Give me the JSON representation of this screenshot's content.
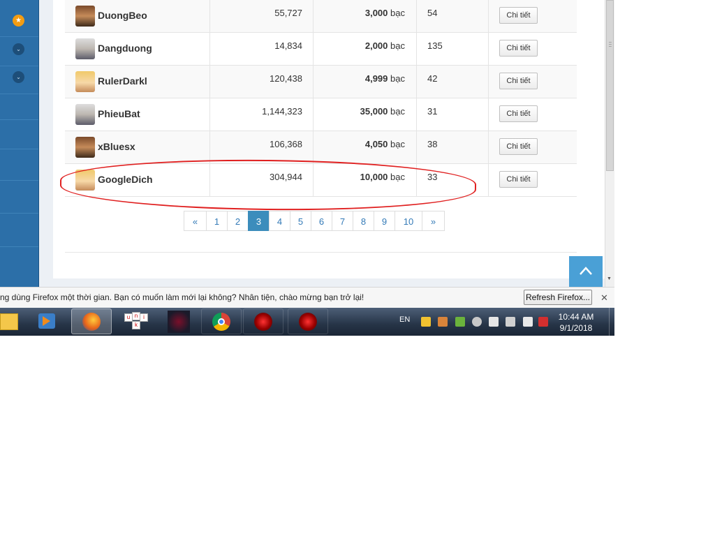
{
  "rows": [
    {
      "name": "DuongBeo",
      "score": "55,727",
      "silver": "3,000",
      "unit": "bạc",
      "level": "54",
      "button": "Chi tiết"
    },
    {
      "name": "Dangduong",
      "score": "14,834",
      "silver": "2,000",
      "unit": "bạc",
      "level": "135",
      "button": "Chi tiết"
    },
    {
      "name": "RulerDarkl",
      "score": "120,438",
      "silver": "4,999",
      "unit": "bạc",
      "level": "42",
      "button": "Chi tiết"
    },
    {
      "name": "PhieuBat",
      "score": "1,144,323",
      "silver": "35,000",
      "unit": "bạc",
      "level": "31",
      "button": "Chi tiết"
    },
    {
      "name": "xBluesx",
      "score": "106,368",
      "silver": "4,050",
      "unit": "bạc",
      "level": "38",
      "button": "Chi tiết"
    },
    {
      "name": "GoogleDich",
      "score": "304,944",
      "silver": "10,000",
      "unit": "bạc",
      "level": "33",
      "button": "Chi tiết"
    }
  ],
  "pagination": {
    "prev": "«",
    "next": "»",
    "pages": [
      "1",
      "2",
      "3",
      "4",
      "5",
      "6",
      "7",
      "8",
      "9",
      "10"
    ],
    "current": "3"
  },
  "notification": {
    "text": "ng dùng Firefox một thời gian. Bạn có muốn làm mới lại không? Nhân tiện, chào mừng bạn trở lại!",
    "button": "Refresh Firefox...",
    "close": "✕"
  },
  "taskbar": {
    "language": "EN",
    "time": "10:44 AM",
    "date": "9/1/2018"
  },
  "icons": {
    "sidebar_star": "★",
    "sidebar_expand": "⌄",
    "scroll_up": "chevron-up",
    "scroll_down": "▼"
  },
  "colors": {
    "sidebar": "#2c6fa8",
    "accent": "#3c8dbc",
    "highlight": "#e02020",
    "scroll_top": "#4aa0d6"
  }
}
